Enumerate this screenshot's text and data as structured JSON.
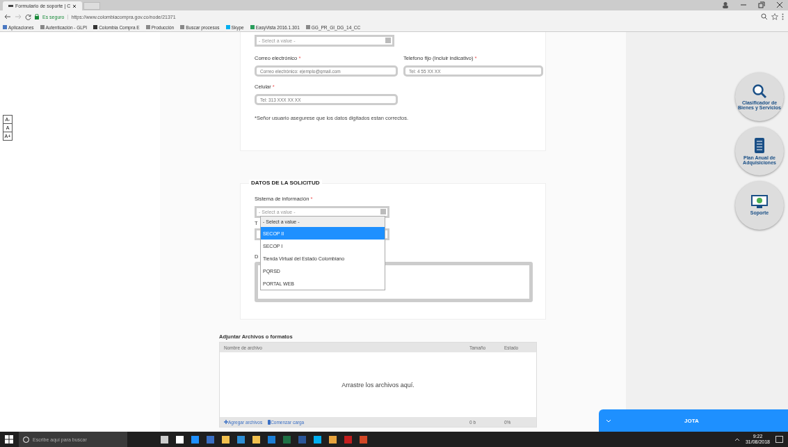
{
  "browser": {
    "tab_title": "Formulario de soporte | C",
    "secure_label": "Es seguro",
    "url": "https://www.colombiacompra.gov.co/node/21371",
    "bookmarks": [
      {
        "label": "Aplicaciones",
        "kind": "apps"
      },
      {
        "label": "Autenticación - GLPI",
        "kind": "page"
      },
      {
        "label": "Colombia Compra E",
        "kind": "site"
      },
      {
        "label": "Producción",
        "kind": "page"
      },
      {
        "label": "Buscar procesos",
        "kind": "page"
      },
      {
        "label": "Skype",
        "kind": "skype"
      },
      {
        "label": "EasyVista 2016.1.301",
        "kind": "easyvista"
      },
      {
        "label": "GG_PR_GI_DG_14_CC",
        "kind": "page"
      }
    ]
  },
  "font_size_buttons": [
    "A-",
    "A",
    "A+"
  ],
  "contact": {
    "top_select": {
      "placeholder": "- Select a value -"
    },
    "email": {
      "label": "Correo electrónico",
      "required_mark": "*",
      "placeholder": "Correo electrónico: ejemplo@gmail.com"
    },
    "phone": {
      "label": "Telefono fijo (Incluir indicativo)",
      "required_mark": "*",
      "placeholder": "Tel: 4 55 XX XX"
    },
    "mobile": {
      "label": "Celular",
      "required_mark": "*",
      "placeholder": "Tel: 313 XXX XX XX"
    },
    "note": "*Señor usuario asegurese que los datos digitados estan correctos."
  },
  "request": {
    "legend": "DATOS DE LA SOLICITUD",
    "system_label": "Sistema de información",
    "system_required_mark": "*",
    "system_select": {
      "value": "- Select a value -"
    },
    "options": [
      {
        "label": "- Select a value -",
        "selected": false
      },
      {
        "label": "SECOP II",
        "selected": true
      },
      {
        "label": "SECOP I",
        "selected": false
      },
      {
        "label": "Tienda Virtual del Estado Colombiano",
        "selected": false
      },
      {
        "label": "PQRSD",
        "selected": false
      },
      {
        "label": "PORTAL WEB",
        "selected": false
      }
    ],
    "covered_label_1": "T",
    "covered_label_2": "D"
  },
  "upload": {
    "title": "Adjuntar Archivos o formatos",
    "columns": [
      "Nombre de archivo",
      "Tamaño",
      "Estado"
    ],
    "drop_text": "Arrastre los archivos aquí.",
    "add_link": "Agregar archivos",
    "start_link": "Comenzar carga",
    "total_size": "0 b",
    "total_status": "0%"
  },
  "side_buttons": [
    {
      "label": "Clasificador de Bienes y Servicios",
      "kind": "search"
    },
    {
      "label": "Plan Anual de Adquisiciones",
      "kind": "document"
    },
    {
      "label": "Soporte",
      "kind": "monitor"
    }
  ],
  "chat": {
    "title": "JOTA"
  },
  "taskbar": {
    "search_placeholder": "Escribe aquí para buscar",
    "time": "9:22",
    "date": "31/08/2018"
  }
}
